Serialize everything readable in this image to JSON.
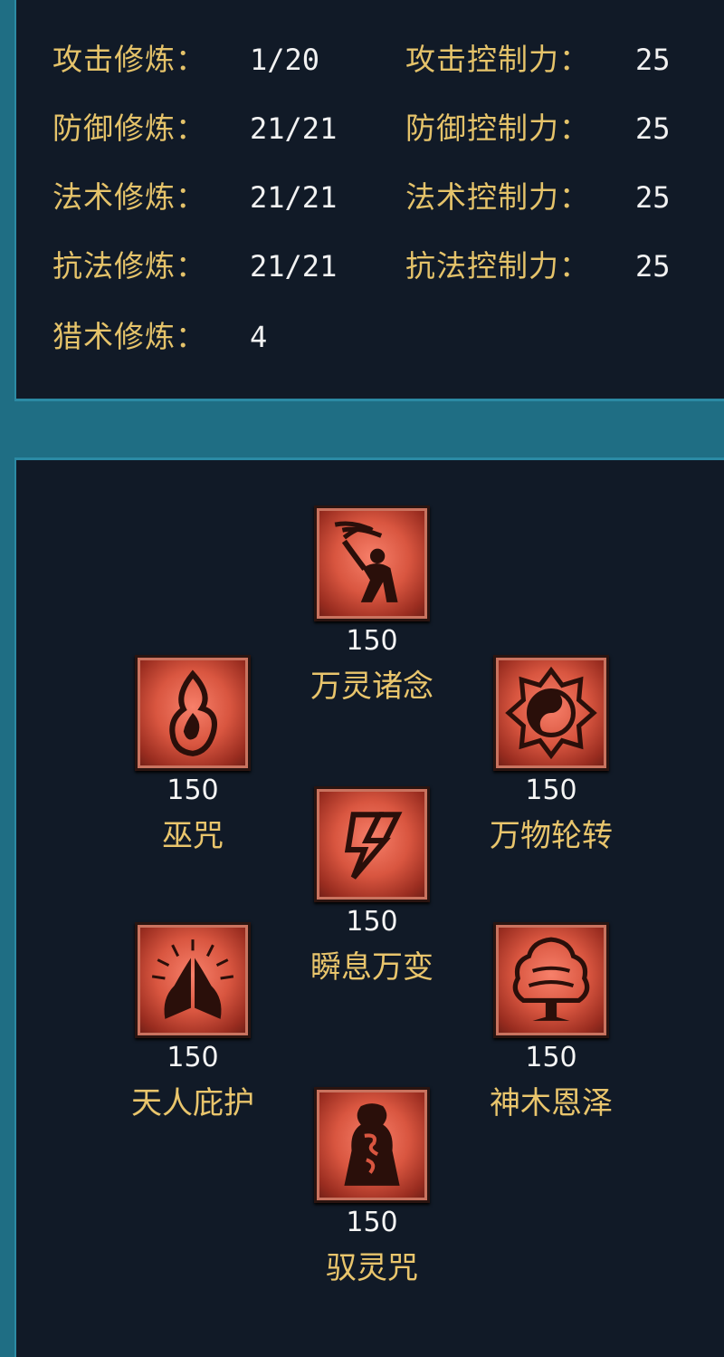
{
  "training": [
    {
      "label": "攻击修炼：",
      "value": "1/20"
    },
    {
      "label": "防御修炼：",
      "value": "21/21"
    },
    {
      "label": "法术修炼：",
      "value": "21/21"
    },
    {
      "label": "抗法修炼：",
      "value": "21/21"
    },
    {
      "label": "猎术修炼：",
      "value": "4"
    }
  ],
  "control": [
    {
      "label": "攻击控制力：",
      "value": "25"
    },
    {
      "label": "防御控制力：",
      "value": "25"
    },
    {
      "label": "法术控制力：",
      "value": "25"
    },
    {
      "label": "抗法控制力：",
      "value": "25"
    }
  ],
  "skills": [
    {
      "name": "万灵诸念",
      "level": "150",
      "icon": "kneeling-figure-icon"
    },
    {
      "name": "巫咒",
      "level": "150",
      "icon": "flame-icon"
    },
    {
      "name": "万物轮转",
      "level": "150",
      "icon": "yin-yang-icon"
    },
    {
      "name": "瞬息万变",
      "level": "150",
      "icon": "lightning-icon"
    },
    {
      "name": "天人庇护",
      "level": "150",
      "icon": "praying-hands-icon"
    },
    {
      "name": "神木恩泽",
      "level": "150",
      "icon": "tree-icon"
    },
    {
      "name": "驭灵咒",
      "level": "150",
      "icon": "spirit-totem-icon"
    }
  ],
  "colors": {
    "label": "#e5c36a",
    "value": "#f2f2f2",
    "panel": "#111a27",
    "frame": "#1f6e84",
    "icon": "#d95640"
  }
}
